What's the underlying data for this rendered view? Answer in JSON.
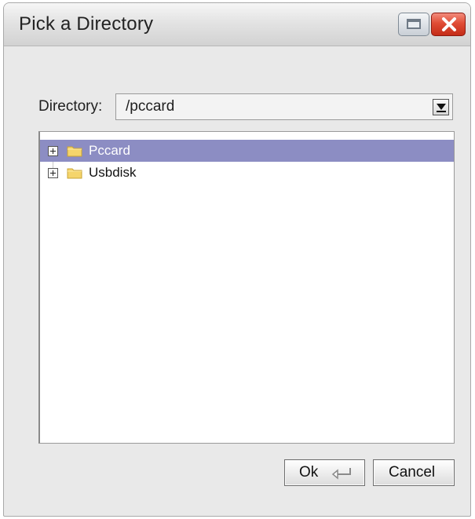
{
  "window": {
    "title": "Pick a Directory"
  },
  "directory": {
    "label": "Directory:",
    "value": "/pccard"
  },
  "tree": {
    "items": [
      {
        "label": "Pccard",
        "selected": true
      },
      {
        "label": "Usbdisk",
        "selected": false
      }
    ]
  },
  "buttons": {
    "ok": "Ok",
    "cancel": "Cancel"
  },
  "colors": {
    "selection": "#8c8dc3",
    "close_button": "#e04c35",
    "folder": "#f5d56b"
  }
}
